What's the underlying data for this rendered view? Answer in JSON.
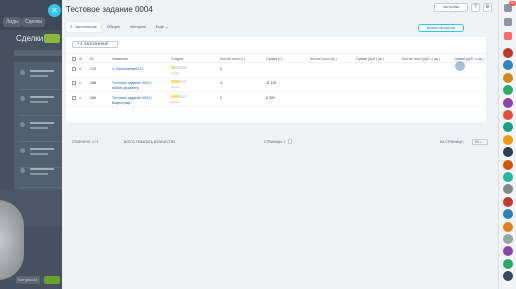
{
  "background": {
    "top_tabs": [
      "Лиды",
      "Сделки"
    ],
    "title": "Сделки",
    "footer_chip": "Битрикс24"
  },
  "window": {
    "title": "Тестовое задание 0004",
    "settings_label": "настройки",
    "close_symbol": "✕",
    "help_symbol": "?",
    "gear_symbol": "⚙",
    "tabs": [
      {
        "label": "З. Заполнение",
        "active": true
      },
      {
        "label": "Общее",
        "active": false
      },
      {
        "label": "История",
        "active": false
      },
      {
        "label": "Ещё ⌄",
        "active": false
      }
    ],
    "bp_button": "Бизнес-процессы"
  },
  "table": {
    "add_button": "+ З. ЗАПОЛНЕНИЕ",
    "columns": [
      "ID",
      "Название",
      "Стадия",
      "Кол-во посл (т.)",
      "Сумма (т.)",
      "Кол-во посл (ф.)",
      "Сумма (руб.) (ф.)",
      "Кол-во посл (руб. с нд.)",
      "Сумма (руб. с нд.)"
    ],
    "rows": [
      {
        "id": "170",
        "name": "3. Заполнение#170",
        "stage": "Создан",
        "stage_filled": 1,
        "qty": "0",
        "sum": ""
      },
      {
        "id": "168",
        "name": "Тестовое задание 0004 / Motion дизайнер",
        "stage": "Выплат",
        "stage_filled": 2,
        "qty": "4",
        "sum": "11 115"
      },
      {
        "id": "166",
        "name": "Тестовое задание 0004 / Видеограф",
        "stage": "Выплат",
        "stage_filled": 2,
        "qty": "2",
        "sum": "6 000"
      }
    ],
    "footer": {
      "selected": "ОТМЕЧЕНО: 0 / 3",
      "total": "ВСЕГО: ПОКАЗАТЬ КОЛИЧЕСТВО",
      "pages": "СТРАНИЦЫ: 1",
      "per_page_label": "НА СТРАНИЦЕ:",
      "per_page_value": "10 ⌄"
    }
  },
  "rail": {
    "badge": "99",
    "avatar_colors": [
      "#c0392b",
      "#2e86c1",
      "#d68910",
      "#27ae60",
      "#8e44ad",
      "#e74c3c",
      "#16a085",
      "#f39c12",
      "#2c3e50",
      "#d35400",
      "#1abc9c",
      "#7f8c8d",
      "#c0392b",
      "#2980b9",
      "#e67e22",
      "#95a5a6",
      "#8e44ad",
      "#27ae60",
      "#34495e"
    ]
  }
}
